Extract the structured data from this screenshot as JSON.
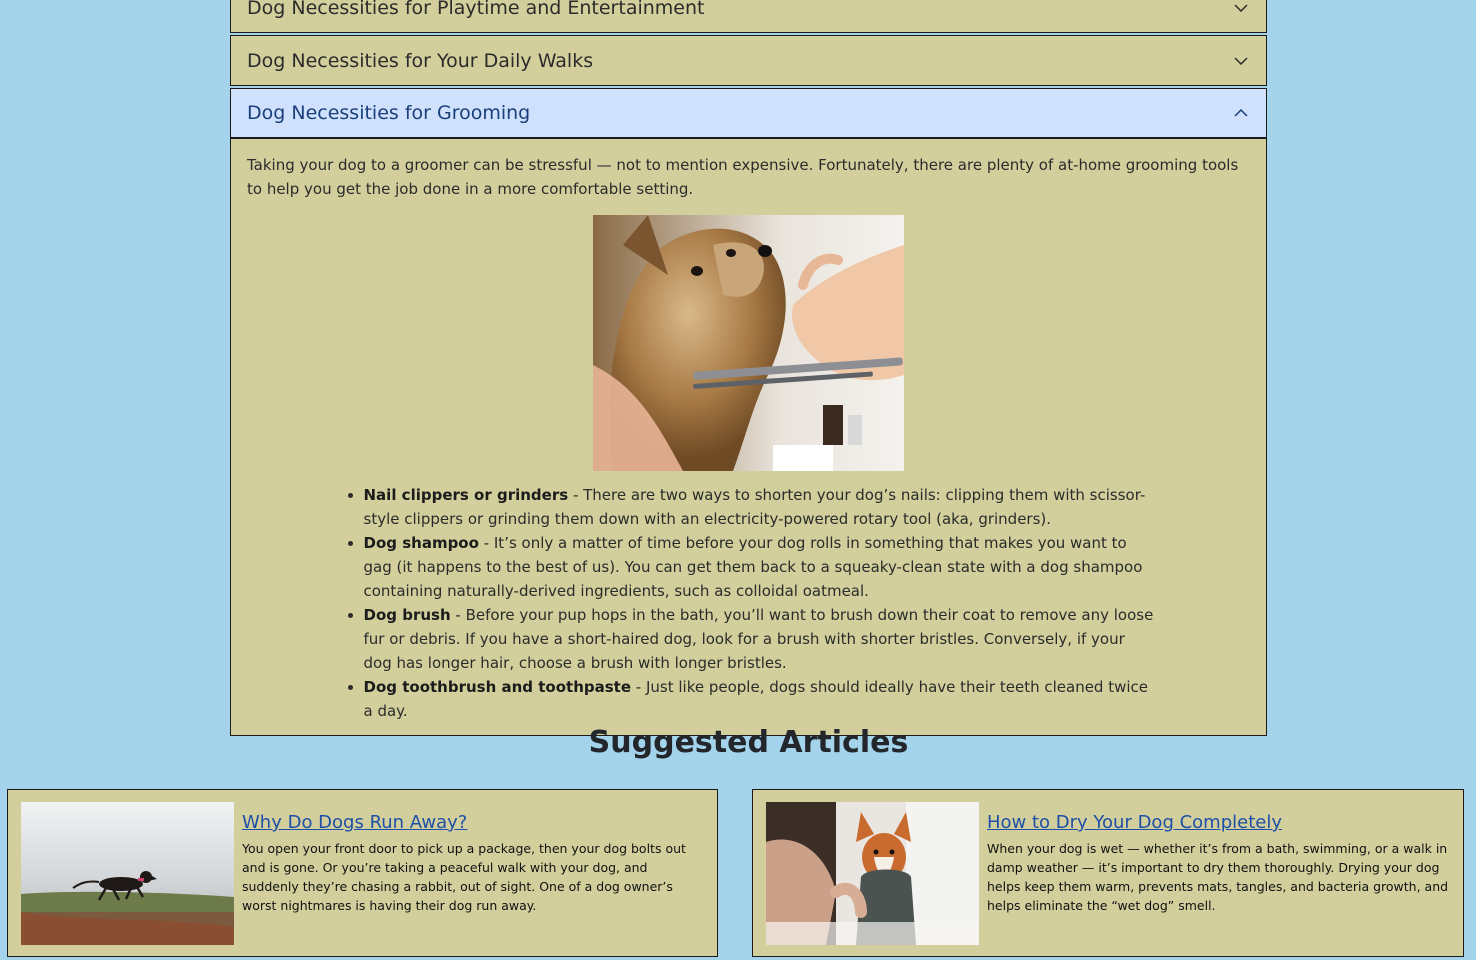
{
  "accordion": {
    "items": [
      {
        "label": "Dog Necessities for Playtime and Entertainment"
      },
      {
        "label": "Dog Necessities for Your Daily Walks"
      },
      {
        "label": "Dog Necessities for Grooming"
      }
    ],
    "grooming": {
      "intro": "Taking your dog to a groomer can be stressful — not to mention expensive. Fortunately, there are plenty of at-home grooming tools to help you get the job done in a more comfortable setting.",
      "list": [
        {
          "term": "Nail clippers or grinders",
          "desc": " - There are two ways to shorten your dog’s nails: clipping them with scissor-style clippers or grinding them down with an electricity-powered rotary tool (aka, grinders)."
        },
        {
          "term": "Dog shampoo",
          "desc": " - It’s only a matter of time before your dog rolls in something that makes you want to gag (it happens to the best of us). You can get them back to a squeaky-clean state with a dog shampoo containing naturally-derived ingredients, such as colloidal oatmeal."
        },
        {
          "term": "Dog brush",
          "desc": " - Before your pup hops in the bath, you’ll want to brush down their coat to remove any loose fur or debris. If you have a short-haired dog, look for a brush with shorter bristles. Conversely, if your dog has longer hair, choose a brush with longer bristles."
        },
        {
          "term": "Dog toothbrush and toothpaste",
          "desc": " - Just like people, dogs should ideally have their teeth cleaned twice a day."
        }
      ]
    }
  },
  "suggested": {
    "heading": "Suggested Articles",
    "articles": [
      {
        "title": "Why Do Dogs Run Away?",
        "summary": "You open your front door to pick up a package, then your dog bolts out and is gone. Or you’re taking a peaceful walk with your dog, and suddenly they’re chasing a rabbit, out of sight. One of a dog owner’s worst nightmares is having their dog run away."
      },
      {
        "title": "How to Dry Your Dog Completely",
        "summary": "When your dog is wet — whether it’s from a bath, swimming, or a walk in damp weather — it’s important to dry them thoroughly. Drying your dog helps keep them warm, prevents mats, tangles, and bacteria growth, and helps eliminate the “wet dog” smell."
      }
    ]
  }
}
